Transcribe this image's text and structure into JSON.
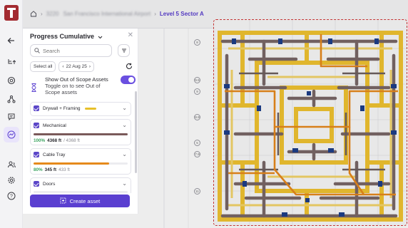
{
  "breadcrumb": {
    "hidden_segment_1": "3220",
    "hidden_segment_2": "San Francisco International Airport",
    "current": "Level 5 Sector A"
  },
  "panel": {
    "title": "Progress Cumulative",
    "search_placeholder": "Search",
    "select_all": "Select all",
    "date": "22 Aug 25",
    "scope_title": "Show Out of Scope Assets",
    "scope_subtitle": "Toggle on to see Out of Scope assets",
    "scope_toggle_on": true,
    "create_button": "Create asset"
  },
  "assets": [
    {
      "label": "Drywall + Framing",
      "color": "#e7c02a",
      "expanded": false
    },
    {
      "label": "Mechanical",
      "color": "#7a5a5a",
      "progress": 1.0,
      "pct": "100%",
      "done": "4368 ft",
      "total": "/ 4368 ft",
      "expanded": true
    },
    {
      "label": "Cable Tray",
      "color": "#e68a1c",
      "progress": 0.8,
      "pct": "80%",
      "done": "345 ft",
      "total": "433 ft",
      "expanded": true
    },
    {
      "label": "Doors",
      "expanded": true
    }
  ],
  "axis_labels": [
    "8",
    "9.5",
    "9",
    "8.9",
    "5",
    "7",
    "7.9",
    "11"
  ],
  "colors": {
    "accent": "#5a3fd0",
    "brand": "#a32b31"
  }
}
